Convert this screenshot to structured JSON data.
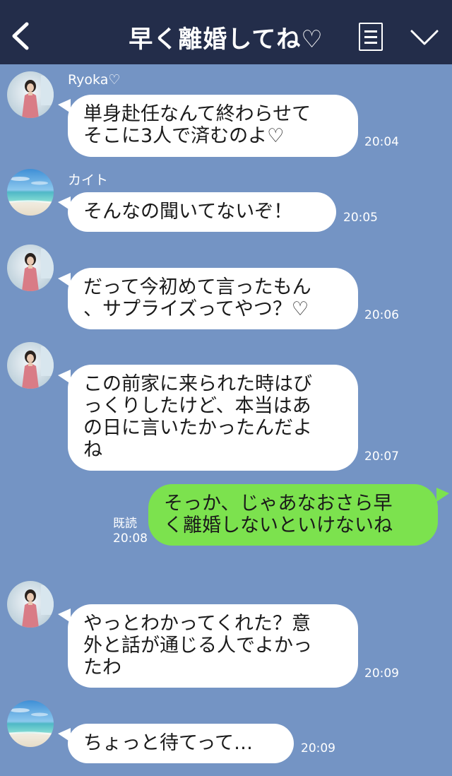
{
  "header": {
    "title": "早く離婚してね♡",
    "background": "#232d4a"
  },
  "theme": {
    "chat_background": "#7494c4",
    "incoming_bubble": "#ffffff",
    "outgoing_bubble": "#7ce24e"
  },
  "messages": [
    {
      "sender": "Ryoka♡",
      "avatar": "woman-avatar",
      "text": "単身赴任なんて終わらせて\nそこに3人で済むのよ♡",
      "time": "20:04"
    },
    {
      "sender": "カイト",
      "avatar": "beach-avatar",
      "text": "そんなの聞いてないぞ！",
      "time": "20:05"
    },
    {
      "sender": "",
      "avatar": "woman-avatar",
      "text": "だって今初めて言ったもん\n、サプライズってやつ？♡",
      "time": "20:06"
    },
    {
      "sender": "",
      "avatar": "woman-avatar",
      "text": "この前家に来られた時はび\nっくりしたけど、本当はあ\nの日に言いたかったんだよ\nね",
      "time": "20:07"
    },
    {
      "sender": "me",
      "text": "そっか、じゃあなおさら早\nく離婚しないといけないね",
      "read_label": "既読",
      "time": "20:08"
    },
    {
      "sender": "",
      "avatar": "woman-avatar",
      "text": "やっとわかってくれた？意\n外と話が通じる人でよかっ\nたわ",
      "time": "20:09"
    },
    {
      "sender": "",
      "avatar": "beach-avatar",
      "text": "ちょっと待てって…",
      "time": "20:09"
    }
  ]
}
